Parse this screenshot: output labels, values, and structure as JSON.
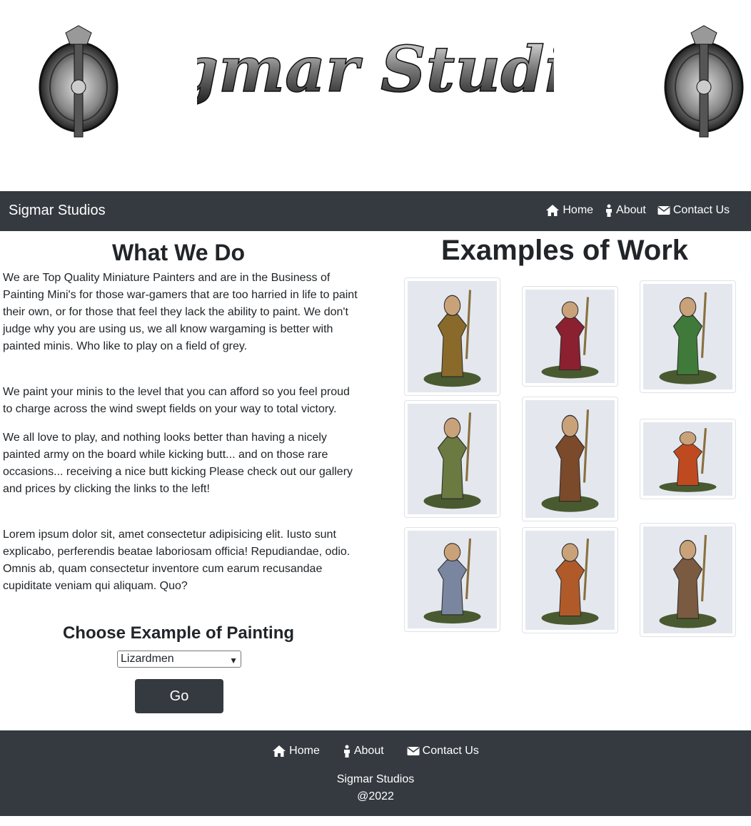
{
  "banner": {
    "logo_text": "Sigmar Studios"
  },
  "navbar": {
    "brand": "Sigmar Studios",
    "links": [
      {
        "label": "Home",
        "icon": "home-icon"
      },
      {
        "label": "About",
        "icon": "person-icon"
      },
      {
        "label": "Contact Us",
        "icon": "envelope-icon"
      }
    ]
  },
  "what_we_do": {
    "heading": "What We Do",
    "paragraphs": [
      "We are Top Quality Miniature Painters and are in the Business of Painting Mini's for those war-gamers that are too harried in life to paint their own, or for those that feel they lack the ability to paint. We don't judge why you are using us, we all know wargaming is better with painted minis. Who like to play on a field of grey.",
      "We paint your minis to the level that you can afford so you feel proud to charge across the wind swept fields on your way to total victory.",
      "We all love to play, and nothing looks better than having a nicely painted army on the board while kicking butt... and on those rare occasions... receiving a nice butt kicking Please check out our gallery and prices by clicking the links to the left!",
      "Lorem ipsum dolor sit, amet consectetur adipisicing elit. Iusto sunt explicabo, perferendis beatae laboriosam officia! Repudiandae, odio. Omnis ab, quam consectetur inventore cum earum recusandae cupiditate veniam qui aliquam. Quo?"
    ]
  },
  "chooser": {
    "heading": "Choose Example of Painting",
    "selected": "Lizardmen",
    "go_label": "Go"
  },
  "examples": {
    "heading": "Examples of Work",
    "images": [
      {
        "name": "miniature-chaos-lord",
        "accent": "#8a6a2a"
      },
      {
        "name": "miniature-red-robed-priest",
        "accent": "#8a2030"
      },
      {
        "name": "miniature-green-marine",
        "accent": "#3f7a3a"
      },
      {
        "name": "miniature-commissar-sword",
        "accent": "#6a7a40"
      },
      {
        "name": "miniature-ogre",
        "accent": "#7a4a2a"
      },
      {
        "name": "miniature-lizard-rider",
        "accent": "#c04a20"
      },
      {
        "name": "miniature-blue-coat-officer",
        "accent": "#7a86a0"
      },
      {
        "name": "miniature-skink-shaman",
        "accent": "#b05a2a"
      },
      {
        "name": "miniature-beastman",
        "accent": "#7a5a40"
      }
    ]
  },
  "footer": {
    "links": [
      {
        "label": "Home",
        "icon": "home-icon"
      },
      {
        "label": "About",
        "icon": "person-icon"
      },
      {
        "label": "Contact Us",
        "icon": "envelope-icon"
      }
    ],
    "brand": "Sigmar Studios",
    "year": "@2022"
  }
}
